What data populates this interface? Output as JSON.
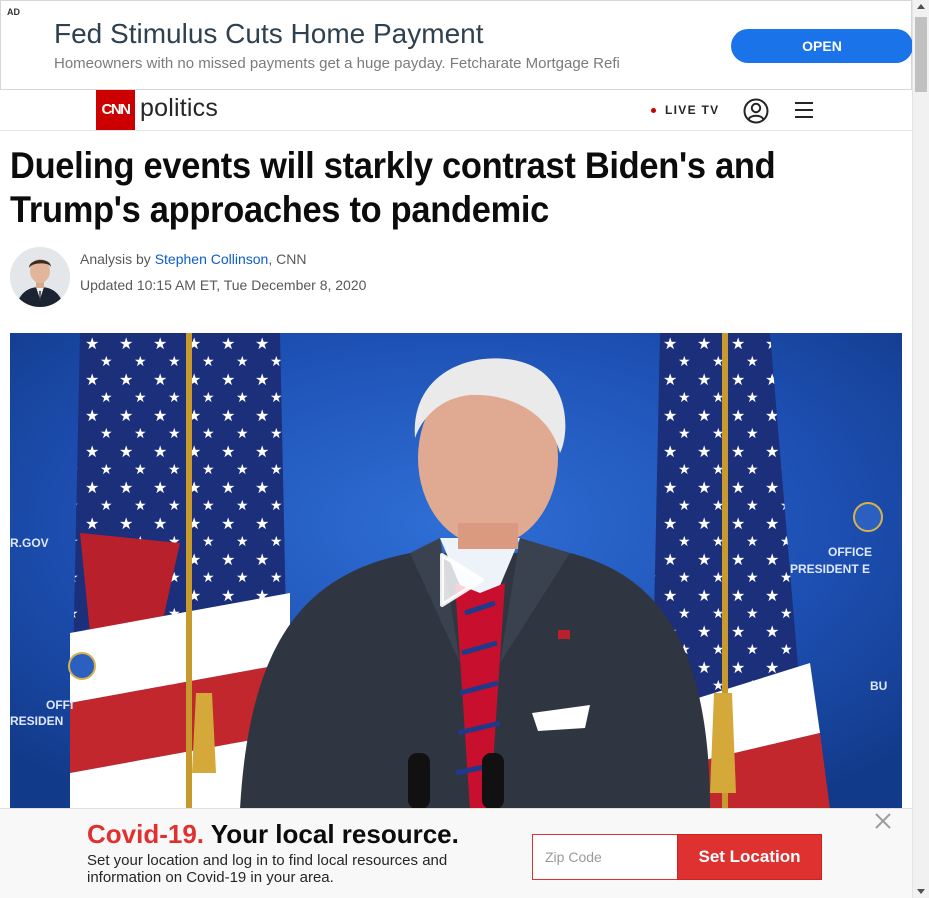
{
  "ad": {
    "tag": "AD",
    "title": "Fed Stimulus Cuts Home Payment",
    "subtitle": "Homeowners with no missed payments get a huge payday. Fetcharate Mortgage Refi",
    "open_label": "OPEN"
  },
  "nav": {
    "logo_text": "CNN",
    "section": "politics",
    "live_tv": "LIVE TV",
    "icons": [
      "user-icon",
      "menu-icon"
    ]
  },
  "article": {
    "headline": "Dueling events will starkly contrast Biden's and Trump's approaches to pandemic",
    "byline_prefix": "Analysis by ",
    "author": "Stephen Collinson",
    "byline_suffix": ", CNN",
    "updated": "Updated 10:15 AM ET, Tue December 8, 2020"
  },
  "video": {
    "sign_left_top": "R.GOV",
    "sign_left_bottom_1": "OFFI",
    "sign_left_bottom_2": "RESIDEN",
    "sign_right_1": "OFFICE",
    "sign_right_2": "PRESIDENT E",
    "sign_right_3": "BU"
  },
  "covid": {
    "title_red": "Covid-19.",
    "title_rest": " Your local resource.",
    "subtitle": "Set your location and log in to find local resources and information on Covid-19 in your area.",
    "zip_placeholder": "Zip Code",
    "set_location_label": "Set Location"
  },
  "colors": {
    "cnn_red": "#cc0000",
    "link_blue": "#0c5ec9",
    "ad_button_blue": "#1a73e8",
    "covid_red": "#e03131"
  }
}
